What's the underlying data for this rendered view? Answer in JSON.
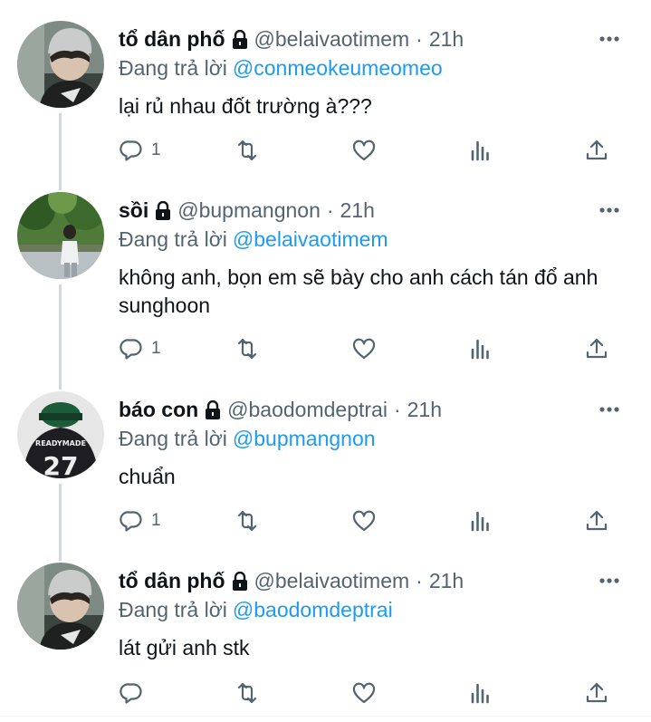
{
  "colors": {
    "link": "#1d9bf0",
    "muted": "#536471",
    "text": "#0f1419",
    "thread_line": "#cfd9de"
  },
  "tweets": [
    {
      "name": "tổ dân phố",
      "handle": "@belaivaotimem",
      "separator": "·",
      "time": "21h",
      "replying_label": "Đang trả lời",
      "replying_to": "@conmeokeumeomeo",
      "text": "lại rủ nhau đốt trường à???",
      "reply_count": "1",
      "avatar_icon": "avatar-beanie-user"
    },
    {
      "name": "sồi",
      "handle": "@bupmangnon",
      "separator": "·",
      "time": "21h",
      "replying_label": "Đang trả lời",
      "replying_to": "@belaivaotimem",
      "text": "không anh, bọn em sẽ bày cho anh cách tán đổ anh sunghoon",
      "reply_count": "1",
      "avatar_icon": "avatar-outdoor-user"
    },
    {
      "name": "báo con",
      "handle": "@baodomdeptrai",
      "separator": "·",
      "time": "21h",
      "replying_label": "Đang trả lời",
      "replying_to": "@bupmangnon",
      "text": "chuẩn",
      "reply_count": "1",
      "avatar_icon": "avatar-jersey-user"
    },
    {
      "name": "tổ dân phố",
      "handle": "@belaivaotimem",
      "separator": "·",
      "time": "21h",
      "replying_label": "Đang trả lời",
      "replying_to": "@baodomdeptrai",
      "text": "lát gửi anh stk",
      "reply_count": "",
      "avatar_icon": "avatar-beanie-user"
    }
  ],
  "jersey_avatar_text": {
    "brand": "READYMADE",
    "number": "27"
  },
  "icons": {
    "lock": "lock-icon",
    "more": "more-icon",
    "reply": "reply-icon",
    "retweet": "retweet-icon",
    "like": "like-icon",
    "views": "views-icon",
    "share": "share-icon"
  }
}
